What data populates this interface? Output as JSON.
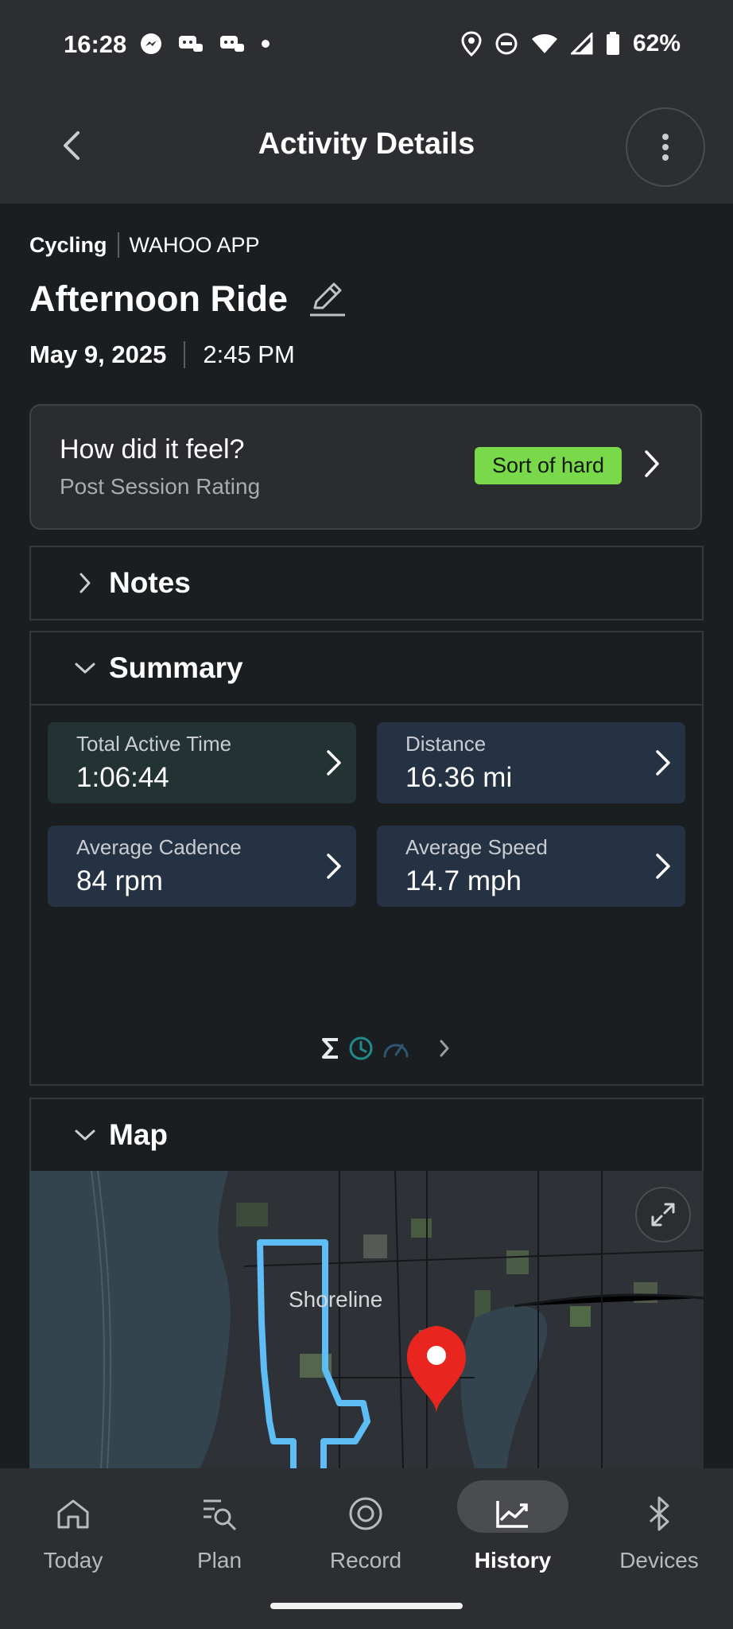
{
  "status_bar": {
    "time": "16:28",
    "battery": "62%"
  },
  "app_bar": {
    "title": "Activity Details"
  },
  "activity": {
    "sport": "Cycling",
    "source": "WAHOO APP",
    "title": "Afternoon Ride",
    "date": "May 9, 2025",
    "time": "2:45 PM"
  },
  "feel_card": {
    "question": "How did it feel?",
    "subtitle": "Post Session Rating",
    "rating": "Sort of hard",
    "rating_color": "#79d94b"
  },
  "sections": {
    "notes": "Notes",
    "summary": "Summary",
    "map": "Map"
  },
  "summary_stats": [
    {
      "title": "Total Active Time",
      "value": "1:06:44"
    },
    {
      "title": "Distance",
      "value": "16.36 mi"
    },
    {
      "title": "Average Cadence",
      "value": "84 rpm"
    },
    {
      "title": "Average Speed",
      "value": "14.7 mph"
    }
  ],
  "map": {
    "city_label": "Shoreline",
    "route_color": "#5fbdf5",
    "pin_color": "#e8261f"
  },
  "bottom_nav": [
    {
      "label": "Today",
      "icon": "home-icon"
    },
    {
      "label": "Plan",
      "icon": "plan-search-icon"
    },
    {
      "label": "Record",
      "icon": "record-icon"
    },
    {
      "label": "History",
      "icon": "history-chart-icon",
      "active": true
    },
    {
      "label": "Devices",
      "icon": "bluetooth-icon"
    }
  ],
  "colors": {
    "background": "#1b1e21",
    "bar": "#2c2e31",
    "stat_card": "#243243",
    "accent_teal": "#1f8c8a"
  }
}
